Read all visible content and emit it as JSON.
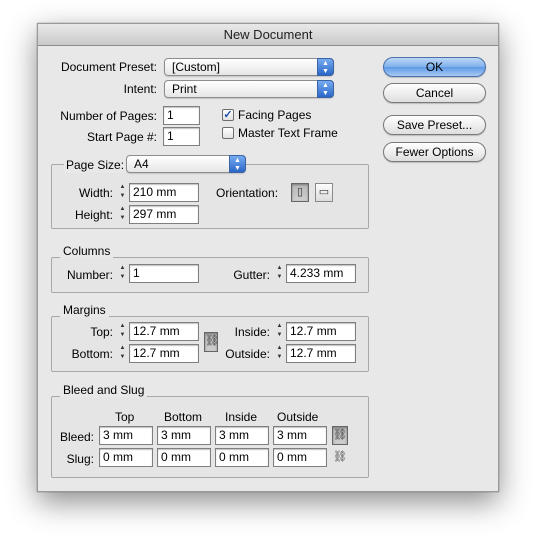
{
  "window": {
    "title": "New Document"
  },
  "preset": {
    "label": "Document Preset:",
    "value": "[Custom]"
  },
  "intent": {
    "label": "Intent:",
    "value": "Print"
  },
  "pages": {
    "num_label": "Number of Pages:",
    "num_value": "1",
    "start_label": "Start Page #:",
    "start_value": "1",
    "facing_label": "Facing Pages",
    "facing_checked": true,
    "master_label": "Master Text Frame",
    "master_checked": false
  },
  "buttons": {
    "ok": "OK",
    "cancel": "Cancel",
    "save_preset": "Save Preset...",
    "fewer_options": "Fewer Options"
  },
  "page_size": {
    "label": "Page Size:",
    "value": "A4",
    "width_label": "Width:",
    "width_value": "210 mm",
    "height_label": "Height:",
    "height_value": "297 mm",
    "orientation_label": "Orientation:",
    "orientation_selected": "portrait"
  },
  "columns": {
    "title": "Columns",
    "number_label": "Number:",
    "number_value": "1",
    "gutter_label": "Gutter:",
    "gutter_value": "4.233 mm"
  },
  "margins": {
    "title": "Margins",
    "top_label": "Top:",
    "top_value": "12.7 mm",
    "bottom_label": "Bottom:",
    "bottom_value": "12.7 mm",
    "inside_label": "Inside:",
    "inside_value": "12.7 mm",
    "outside_label": "Outside:",
    "outside_value": "12.7 mm"
  },
  "bleed_slug": {
    "title": "Bleed and Slug",
    "headers": [
      "Top",
      "Bottom",
      "Inside",
      "Outside"
    ],
    "bleed_label": "Bleed:",
    "bleed_values": [
      "3 mm",
      "3 mm",
      "3 mm",
      "3 mm"
    ],
    "slug_label": "Slug:",
    "slug_values": [
      "0 mm",
      "0 mm",
      "0 mm",
      "0 mm"
    ]
  },
  "icons": {
    "checkmark": "✓",
    "spinner_up": "▲",
    "spinner_down": "▼",
    "link": "chain-link-icon"
  }
}
